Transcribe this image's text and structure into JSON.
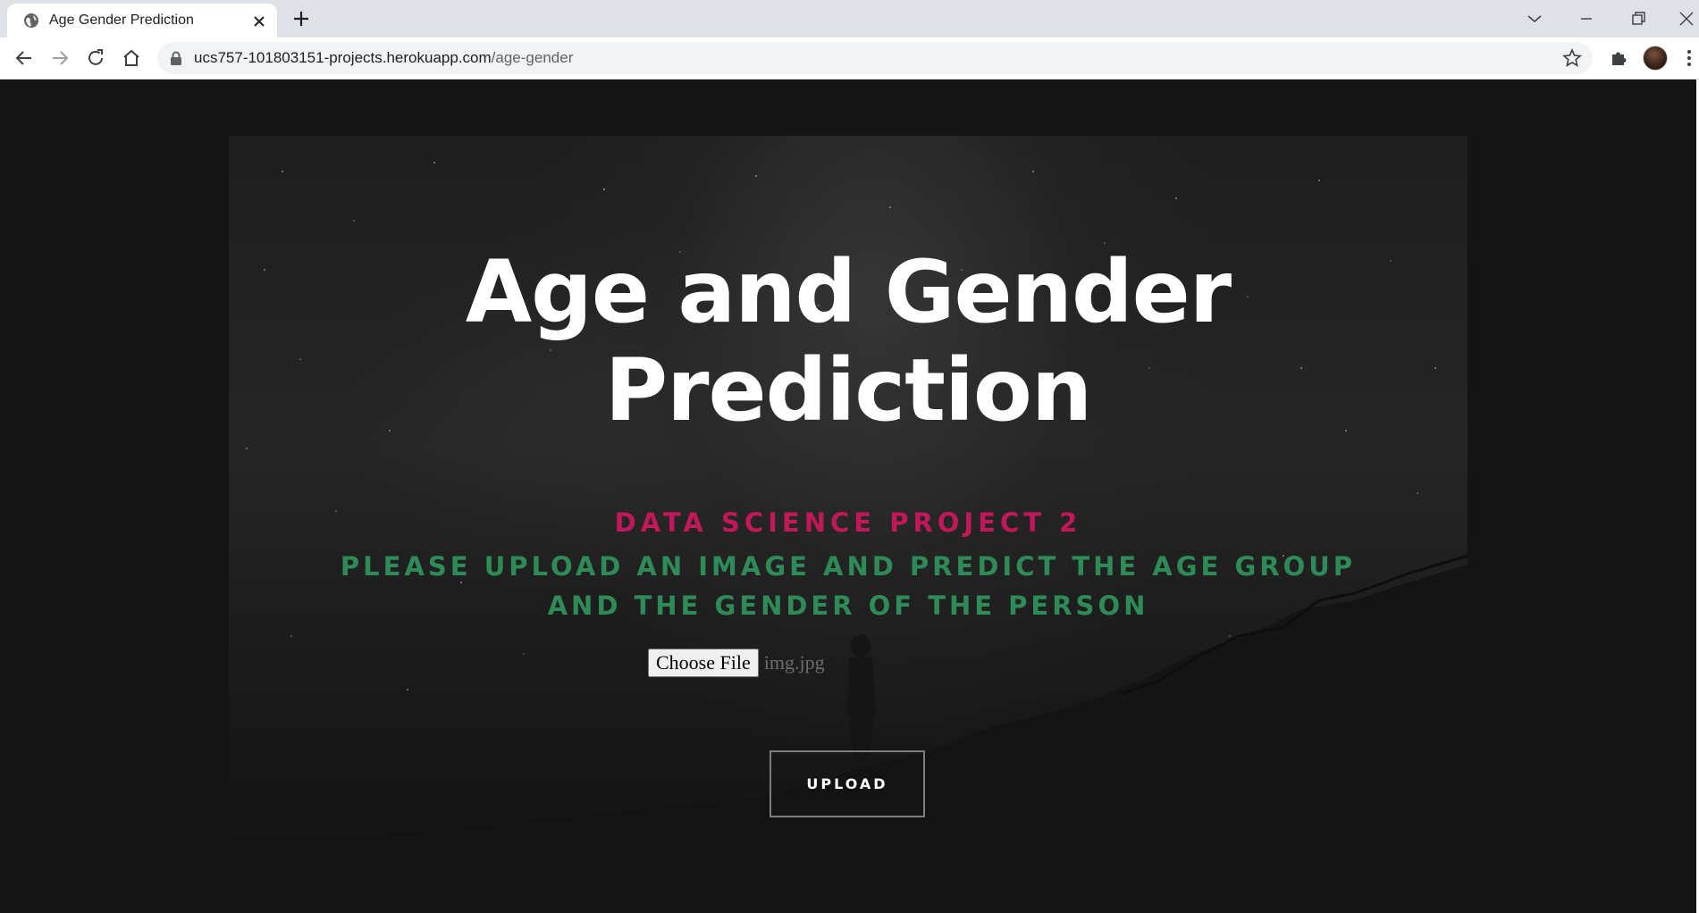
{
  "browser": {
    "tab_title": "Age Gender Prediction",
    "url_host": "ucs757-101803151-projects.herokuapp.com",
    "url_path": "/age-gender",
    "icons": {
      "favicon": "globe-icon",
      "tab_close": "close-icon",
      "new_tab": "plus-icon",
      "tab_search": "chevron-down-icon",
      "minimize": "minimize-icon",
      "restore": "restore-icon",
      "close_window": "close-icon",
      "back": "back-arrow-icon",
      "forward": "forward-arrow-icon",
      "reload": "reload-icon",
      "home": "home-icon",
      "lock": "lock-icon",
      "bookmark": "star-icon",
      "extensions": "puzzle-icon",
      "menu": "kebab-menu-icon"
    }
  },
  "page": {
    "title_line1": "Age and Gender",
    "title_line2": "Prediction",
    "subtitle": "Data Science Project 2",
    "instruction": "Please upload an image and predict the age group and the gender of the person",
    "choose_file_label": "Choose File",
    "file_name": "img.jpg",
    "upload_label": "UPLOAD",
    "colors": {
      "subtitle": "#c1185a",
      "instruction": "#2e8b57",
      "background": "#141414"
    }
  }
}
